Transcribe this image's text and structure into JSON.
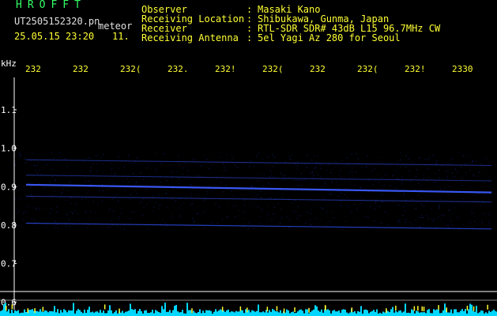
{
  "header": {
    "logo": "HROFFT",
    "filename": "UT2505152320.pn",
    "mode": "meteor",
    "datetime": "25.05.15 23:20",
    "count": "11.",
    "fields": [
      {
        "label": "Observer",
        "value": "Masaki Kano"
      },
      {
        "label": "Receiving Location",
        "value": "Shibukawa, Gunma, Japan"
      },
      {
        "label": "Receiver",
        "value": "RTL-SDR SDR# 43dB L15 96.7MHz CW"
      },
      {
        "label": "Receiving Antenna",
        "value": "5el Yagi Az 280 for Seoul"
      }
    ]
  },
  "axis": {
    "unit": "kHz",
    "y_ticks": [
      "1.1",
      "1.0",
      "0.9",
      "0.8",
      "0.7",
      "0.6"
    ],
    "x_ticks": [
      "232",
      "232",
      "232(",
      "232.",
      "232!",
      "232(",
      "232",
      "232(",
      "232!",
      "2330"
    ]
  },
  "colors": {
    "background": "#000000",
    "header_text": "#ffff33",
    "logo": "#33ff66",
    "trace": "#3355ff",
    "noise_floor": "#00d7ff"
  },
  "chart_data": {
    "type": "heatmap",
    "title": "",
    "ylabel": "kHz",
    "ylim": [
      0.58,
      1.18
    ],
    "x": [
      "232",
      "232",
      "232(",
      "232.",
      "232!",
      "232(",
      "232",
      "232(",
      "232!",
      "2330"
    ],
    "series": [
      {
        "values": [
          0.905,
          0.885
        ]
      },
      {
        "values": [
          0.97,
          0.955
        ]
      },
      {
        "values": [
          0.93,
          0.915
        ]
      },
      {
        "values": [
          0.875,
          0.86
        ]
      },
      {
        "values": [
          0.805,
          0.79
        ]
      }
    ]
  }
}
